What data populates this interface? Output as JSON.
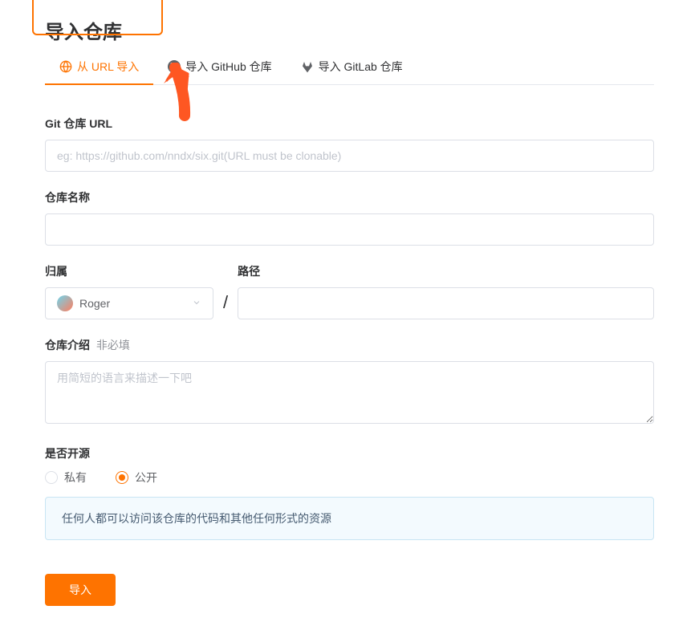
{
  "page": {
    "title": "导入仓库"
  },
  "tabs": {
    "url": {
      "label": "从 URL 导入"
    },
    "github": {
      "label": "导入 GitHub 仓库"
    },
    "gitlab": {
      "label": "导入 GitLab 仓库"
    }
  },
  "form": {
    "gitUrl": {
      "label": "Git 仓库 URL",
      "placeholder": "eg: https://github.com/nndx/six.git(URL must be clonable)"
    },
    "repoName": {
      "label": "仓库名称"
    },
    "owner": {
      "label": "归属",
      "value": "Roger"
    },
    "path": {
      "label": "路径"
    },
    "description": {
      "label": "仓库介绍",
      "optional": "非必填",
      "placeholder": "用简短的语言来描述一下吧"
    },
    "visibility": {
      "label": "是否开源",
      "private": "私有",
      "public": "公开"
    },
    "publicInfo": "任何人都可以访问该仓库的代码和其他任何形式的资源",
    "submit": "导入"
  }
}
